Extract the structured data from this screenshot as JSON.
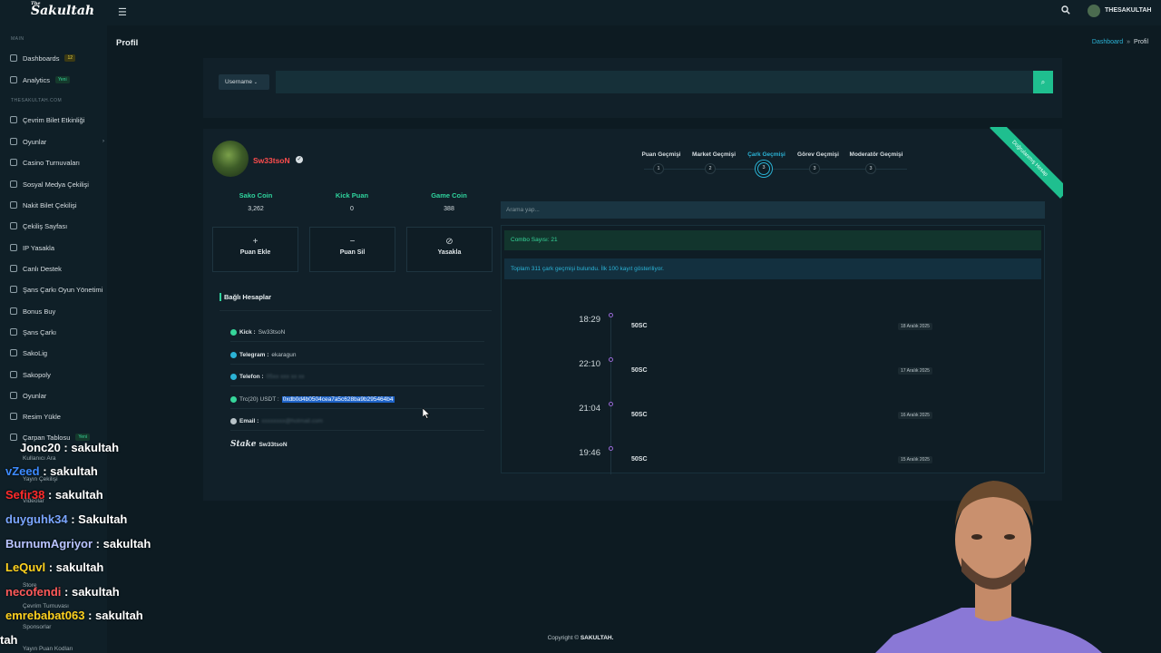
{
  "app": {
    "logo": "Sakultah",
    "logo_top": "The"
  },
  "sidebar": {
    "section_main": "MAIN",
    "section_site": "THESAKULTAH.COM",
    "items": [
      {
        "label": "Dashboards",
        "badge": "12",
        "badge_type": "yellow"
      },
      {
        "label": "Analytics",
        "badge": "Yeni",
        "badge_type": "green"
      },
      {
        "label": "Çevrim Bilet Etkinliği"
      },
      {
        "label": "Oyunlar",
        "has_children": true
      },
      {
        "label": "Casino Turnuvaları"
      },
      {
        "label": "Sosyal Medya Çekilişi"
      },
      {
        "label": "Nakit Bilet Çekilişi"
      },
      {
        "label": "Çekiliş Sayfası"
      },
      {
        "label": "IP Yasakla"
      },
      {
        "label": "Canlı Destek"
      },
      {
        "label": "Şans Çarkı Oyun Yönetimi"
      },
      {
        "label": "Bonus Buy"
      },
      {
        "label": "Şans Çarkı"
      },
      {
        "label": "SakoLig"
      },
      {
        "label": "Sakopoly"
      },
      {
        "label": "Oyunlar"
      },
      {
        "label": "Resim Yükle"
      },
      {
        "label": "Çarpan Tablosu",
        "badge": "Yeni",
        "badge_type": "green"
      }
    ],
    "hidden_items": [
      "Kullanıcı Ara",
      "Yayın Çekilişi",
      "Videolar",
      "Store",
      "Çevrim Turnuvası",
      "Sponsorlar",
      "Yayın Puan Kodları"
    ]
  },
  "topbar": {
    "user_name": "THESAKULTAH"
  },
  "page": {
    "title": "Profil",
    "breadcrumb": [
      "Dashboard",
      "Profil"
    ]
  },
  "search": {
    "select_value": "Username",
    "input_value": ""
  },
  "profile": {
    "username": "Sw33tsoN",
    "stats": [
      {
        "label": "Sako Coin",
        "value": "3,262"
      },
      {
        "label": "Kick Puan",
        "value": "0"
      },
      {
        "label": "Game Coin",
        "value": "388"
      }
    ],
    "actions": [
      {
        "label": "Puan Ekle",
        "icon": "plus-icon"
      },
      {
        "label": "Puan Sil",
        "icon": "minus-icon"
      },
      {
        "label": "Yasakla",
        "icon": "ban-icon"
      }
    ],
    "linked_title": "Bağlı Hesaplar",
    "accounts": [
      {
        "key": "Kick :",
        "value": "Sw33tsoN",
        "color": "#36d69a"
      },
      {
        "key": "Telegram :",
        "value": "ekaragun",
        "color": "#2bb3d6"
      },
      {
        "key": "Telefon :",
        "value": "05xx xxx xx xx",
        "color": "#2bb3d6"
      },
      {
        "key": "Trc(20) USDT :",
        "value": "0xdb0d4b0504cea7a5c628ba9b295464b4",
        "color": "#36d69a"
      },
      {
        "key": "Email :",
        "value": "xxxxxxxx@hotmail.com",
        "color": "#b8c3c8"
      },
      {
        "key": "Stake",
        "value": "Sw33tsoN"
      }
    ]
  },
  "tabs": [
    {
      "label": "Puan Geçmişi",
      "count": "1"
    },
    {
      "label": "Market Geçmişi",
      "count": "2"
    },
    {
      "label": "Çark Geçmişi",
      "count": "3",
      "active": true
    },
    {
      "label": "Görev Geçmişi",
      "count": "3"
    },
    {
      "label": "Moderatör Geçmişi",
      "count": "3"
    }
  ],
  "ribbon": "Doğrulanmış Hesap",
  "history": {
    "filter_placeholder": "Arama yap...",
    "combo": "Combo Sayısı: 21",
    "info": "Toplam 311 çark geçmişi bulundu. İlk 100 kayıt gösteriliyor.",
    "entries": [
      {
        "time": "18:29",
        "value": "50SC",
        "date": "18 Aralık 2025"
      },
      {
        "time": "22:10",
        "value": "50SC",
        "date": "17 Aralık 2025"
      },
      {
        "time": "21:04",
        "value": "50SC",
        "date": "16 Aralık 2025"
      },
      {
        "time": "19:46",
        "value": "50SC",
        "date": "15 Aralık 2025"
      }
    ]
  },
  "chat": [
    {
      "user": "Jonc20",
      "msg": " : sakultah",
      "color": "#ffffff"
    },
    {
      "user": "vZeed",
      "msg": " : sakultah",
      "color": "#3d8bff"
    },
    {
      "user": "Sefir38",
      "msg": " : sakultah",
      "color": "#ff2b2b"
    },
    {
      "user": "duyguhk34",
      "msg": " : Sakultah",
      "color": "#7aa6ff"
    },
    {
      "user": "BurnumAgriyor",
      "msg": " : sakultah",
      "color": "#b9c3ff"
    },
    {
      "user": "LeQuvl",
      "msg": " : sakultah",
      "color": "#ffd21f"
    },
    {
      "user": "necofendi",
      "msg": " : sakultah",
      "color": "#ff5a5a"
    },
    {
      "user": "emrebabat063",
      "msg": " : sakultah",
      "color": "#ffd21f"
    },
    {
      "user": "",
      "msg": "tah",
      "color": "#ffffff"
    }
  ],
  "footer": {
    "prefix": "Copyright ©",
    "brand": "SAKULTAH."
  }
}
